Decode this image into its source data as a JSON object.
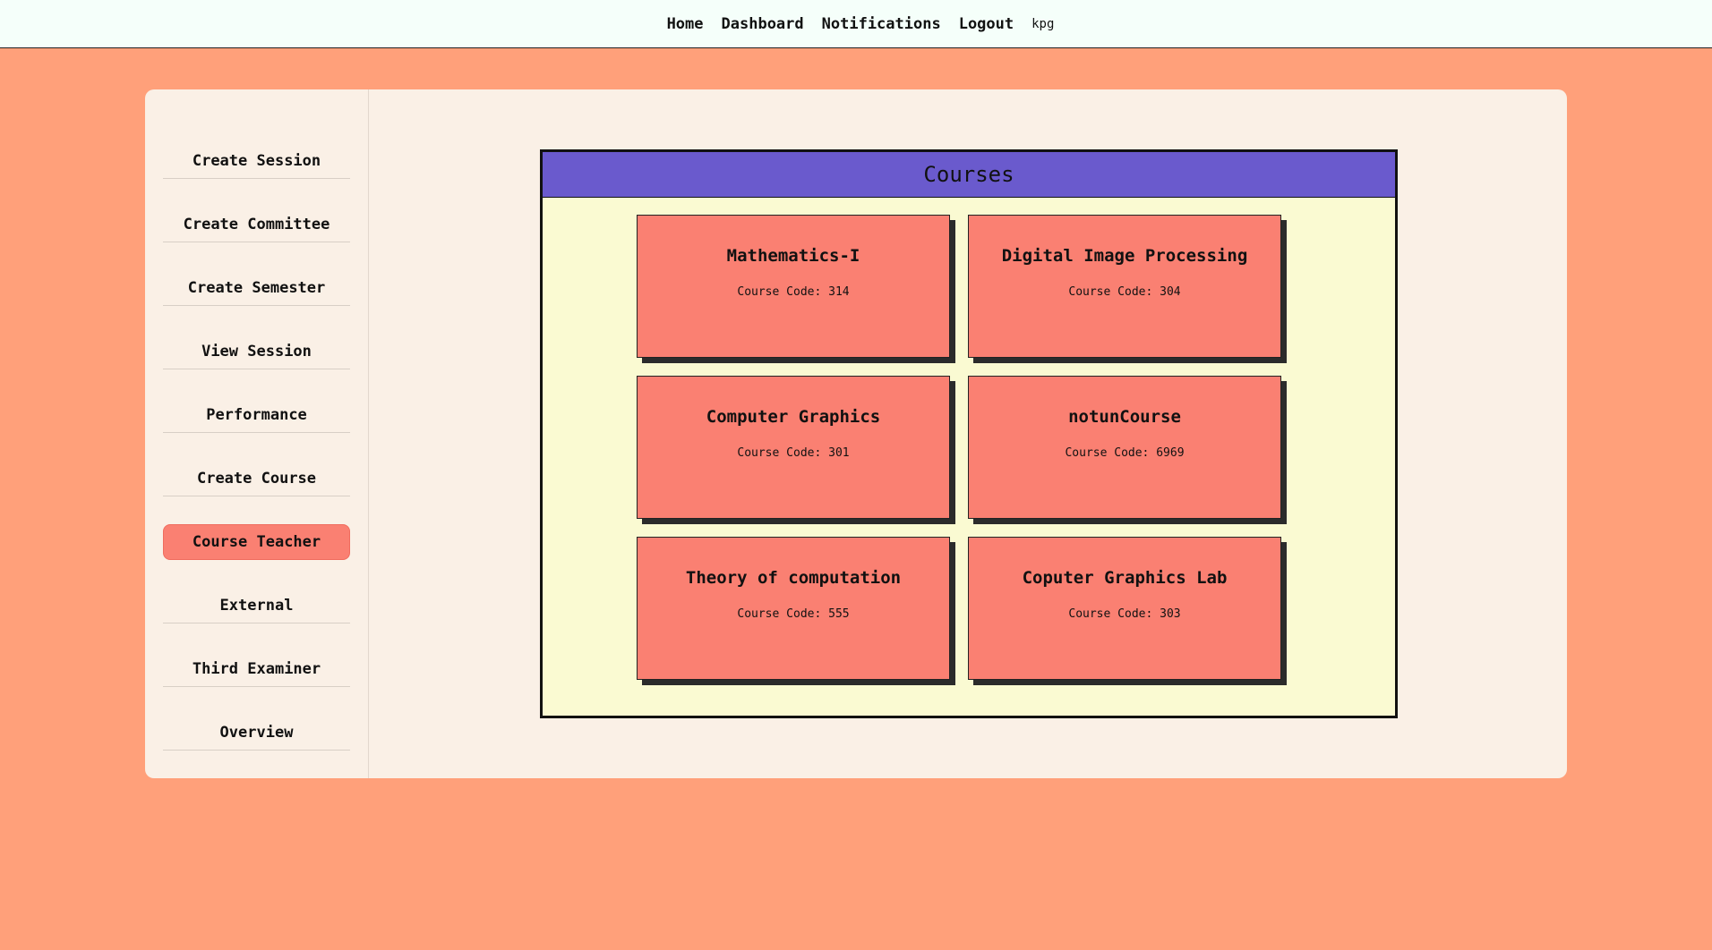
{
  "nav": {
    "home": "Home",
    "dashboard": "Dashboard",
    "notifications": "Notifications",
    "logout": "Logout",
    "user": "kpg"
  },
  "sidebar": {
    "items": [
      {
        "label": "Create Session"
      },
      {
        "label": "Create Committee"
      },
      {
        "label": "Create Semester"
      },
      {
        "label": "View Session"
      },
      {
        "label": "Performance"
      },
      {
        "label": "Create Course"
      },
      {
        "label": "Course Teacher",
        "active": true
      },
      {
        "label": "External"
      },
      {
        "label": "Third Examiner"
      },
      {
        "label": "Overview"
      }
    ]
  },
  "courses": {
    "title": "Courses",
    "code_prefix": "Course Code:",
    "items": [
      {
        "name": "Mathematics-I",
        "code": "Course Code: 314"
      },
      {
        "name": "Digital Image Processing",
        "code": "Course Code: 304"
      },
      {
        "name": "Computer Graphics",
        "code": "Course Code: 301"
      },
      {
        "name": "notunCourse",
        "code": "Course Code: 6969"
      },
      {
        "name": "Theory of computation",
        "code": "Course Code: 555"
      },
      {
        "name": "Coputer Graphics Lab",
        "code": "Course Code: 303"
      }
    ]
  },
  "colors": {
    "background": "#ffa07a",
    "panel": "#faf0e6",
    "header": "#6a5acd",
    "courses_bg": "#fafad2",
    "card": "#fa8072",
    "active_item": "#fa8072"
  }
}
